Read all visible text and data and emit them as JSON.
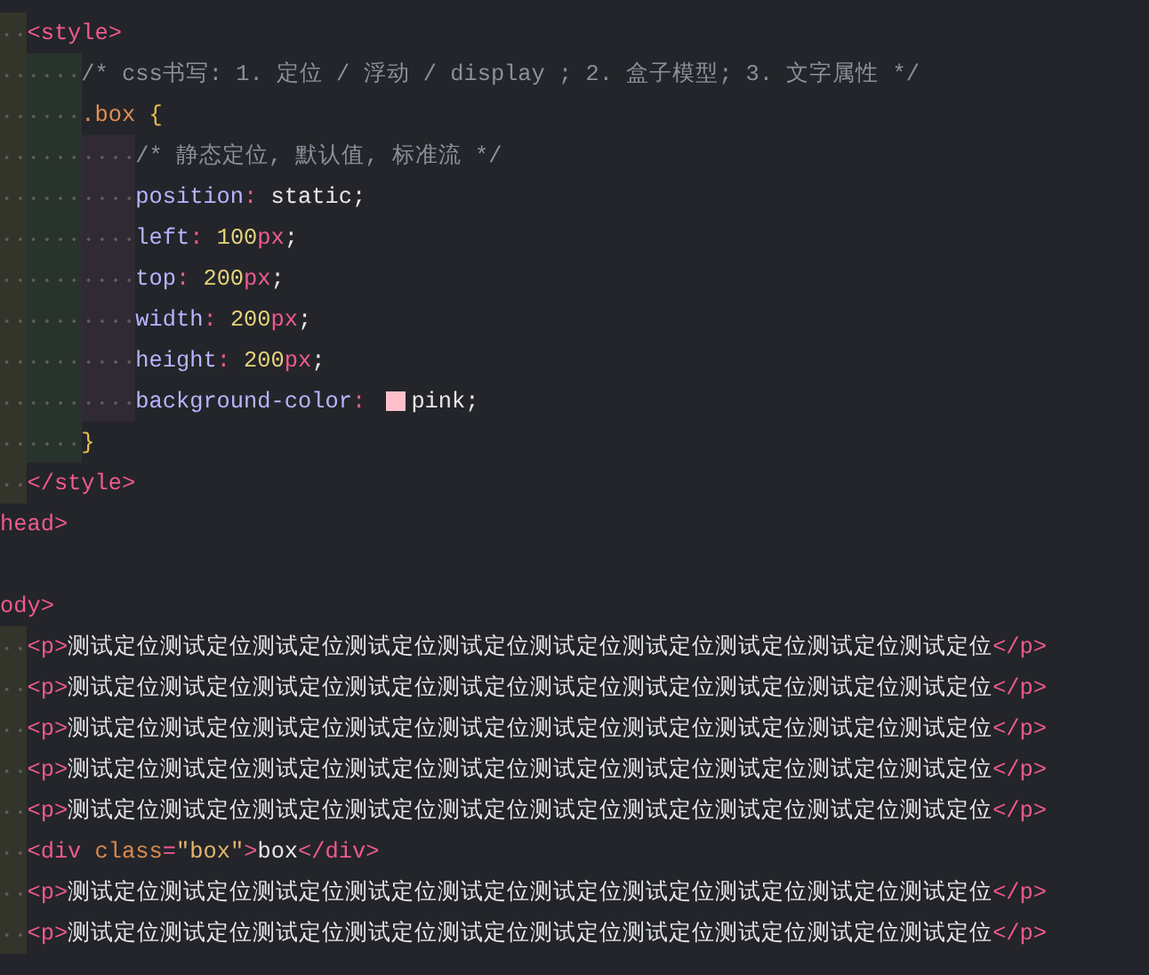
{
  "editor": {
    "lines": [
      {
        "children": [
          {
            "tokens": [
              {
                "kind": "tag",
                "text": "<style>"
              }
            ],
            "children": [
              {
                "tokens": [
                  {
                    "kind": "comment",
                    "text": "/* css书写: 1. 定位 / 浮动 / display ; 2. 盒子模型; 3. 文字属性 */"
                  }
                ]
              },
              {
                "tokens": [
                  {
                    "kind": "selector",
                    "text": ".box "
                  },
                  {
                    "kind": "brace",
                    "text": "{"
                  }
                ],
                "children": [
                  {
                    "tokens": [
                      {
                        "kind": "comment",
                        "text": "/* 静态定位, 默认值, 标准流 */"
                      }
                    ]
                  },
                  {
                    "tokens": [
                      {
                        "kind": "prop",
                        "text": "position"
                      },
                      {
                        "kind": "punct",
                        "text": ": "
                      },
                      {
                        "kind": "text",
                        "text": "static;"
                      }
                    ]
                  },
                  {
                    "tokens": [
                      {
                        "kind": "prop",
                        "text": "left"
                      },
                      {
                        "kind": "punct",
                        "text": ": "
                      },
                      {
                        "kind": "num",
                        "text": "100"
                      },
                      {
                        "kind": "unit",
                        "text": "px"
                      },
                      {
                        "kind": "text",
                        "text": ";"
                      }
                    ]
                  },
                  {
                    "tokens": [
                      {
                        "kind": "prop",
                        "text": "top"
                      },
                      {
                        "kind": "punct",
                        "text": ": "
                      },
                      {
                        "kind": "num",
                        "text": "200"
                      },
                      {
                        "kind": "unit",
                        "text": "px"
                      },
                      {
                        "kind": "text",
                        "text": ";"
                      }
                    ]
                  },
                  {
                    "tokens": [
                      {
                        "kind": "prop",
                        "text": "width"
                      },
                      {
                        "kind": "punct",
                        "text": ": "
                      },
                      {
                        "kind": "num",
                        "text": "200"
                      },
                      {
                        "kind": "unit",
                        "text": "px"
                      },
                      {
                        "kind": "text",
                        "text": ";"
                      }
                    ]
                  },
                  {
                    "tokens": [
                      {
                        "kind": "prop",
                        "text": "height"
                      },
                      {
                        "kind": "punct",
                        "text": ": "
                      },
                      {
                        "kind": "num",
                        "text": "200"
                      },
                      {
                        "kind": "unit",
                        "text": "px"
                      },
                      {
                        "kind": "text",
                        "text": ";"
                      }
                    ]
                  },
                  {
                    "tokens": [
                      {
                        "kind": "prop",
                        "text": "background-color"
                      },
                      {
                        "kind": "punct",
                        "text": ": "
                      },
                      {
                        "kind": "swatch",
                        "color": "#ffc0cb"
                      },
                      {
                        "kind": "text",
                        "text": "pink;"
                      }
                    ]
                  }
                ]
              },
              {
                "tokens": [
                  {
                    "kind": "brace",
                    "text": "}"
                  }
                ]
              }
            ]
          },
          {
            "tokens": [
              {
                "kind": "tag",
                "text": "</style>"
              }
            ]
          }
        ]
      },
      {
        "tokens": [
          {
            "kind": "tag",
            "text": "head>"
          }
        ]
      },
      {
        "kind": "blank"
      },
      {
        "tokens": [
          {
            "kind": "tag",
            "text": "ody>"
          }
        ],
        "children": [
          {
            "tokens": [
              {
                "kind": "tag",
                "text": "<p>"
              },
              {
                "kind": "text",
                "text": "测试定位测试定位测试定位测试定位测试定位测试定位测试定位测试定位测试定位测试定位"
              },
              {
                "kind": "tag",
                "text": "</p>"
              }
            ]
          },
          {
            "tokens": [
              {
                "kind": "tag",
                "text": "<p>"
              },
              {
                "kind": "text",
                "text": "测试定位测试定位测试定位测试定位测试定位测试定位测试定位测试定位测试定位测试定位"
              },
              {
                "kind": "tag",
                "text": "</p>"
              }
            ]
          },
          {
            "tokens": [
              {
                "kind": "tag",
                "text": "<p>"
              },
              {
                "kind": "text",
                "text": "测试定位测试定位测试定位测试定位测试定位测试定位测试定位测试定位测试定位测试定位"
              },
              {
                "kind": "tag",
                "text": "</p>"
              }
            ]
          },
          {
            "tokens": [
              {
                "kind": "tag",
                "text": "<p>"
              },
              {
                "kind": "text",
                "text": "测试定位测试定位测试定位测试定位测试定位测试定位测试定位测试定位测试定位测试定位"
              },
              {
                "kind": "tag",
                "text": "</p>"
              }
            ]
          },
          {
            "tokens": [
              {
                "kind": "tag",
                "text": "<p>"
              },
              {
                "kind": "text",
                "text": "测试定位测试定位测试定位测试定位测试定位测试定位测试定位测试定位测试定位测试定位"
              },
              {
                "kind": "tag",
                "text": "</p>"
              }
            ]
          },
          {
            "tokens": [
              {
                "kind": "tag",
                "text": "<div "
              },
              {
                "kind": "attr",
                "text": "class"
              },
              {
                "kind": "punct",
                "text": "="
              },
              {
                "kind": "string",
                "text": "\"box\""
              },
              {
                "kind": "tag",
                "text": ">"
              },
              {
                "kind": "text",
                "text": "box"
              },
              {
                "kind": "tag",
                "text": "</div>"
              }
            ]
          },
          {
            "tokens": [
              {
                "kind": "tag",
                "text": "<p>"
              },
              {
                "kind": "text",
                "text": "测试定位测试定位测试定位测试定位测试定位测试定位测试定位测试定位测试定位测试定位"
              },
              {
                "kind": "tag",
                "text": "</p>"
              }
            ]
          },
          {
            "tokens": [
              {
                "kind": "tag",
                "text": "<p>"
              },
              {
                "kind": "text",
                "text": "测试定位测试定位测试定位测试定位测试定位测试定位测试定位测试定位测试定位测试定位"
              },
              {
                "kind": "tag",
                "text": "</p>"
              }
            ]
          }
        ]
      }
    ]
  }
}
